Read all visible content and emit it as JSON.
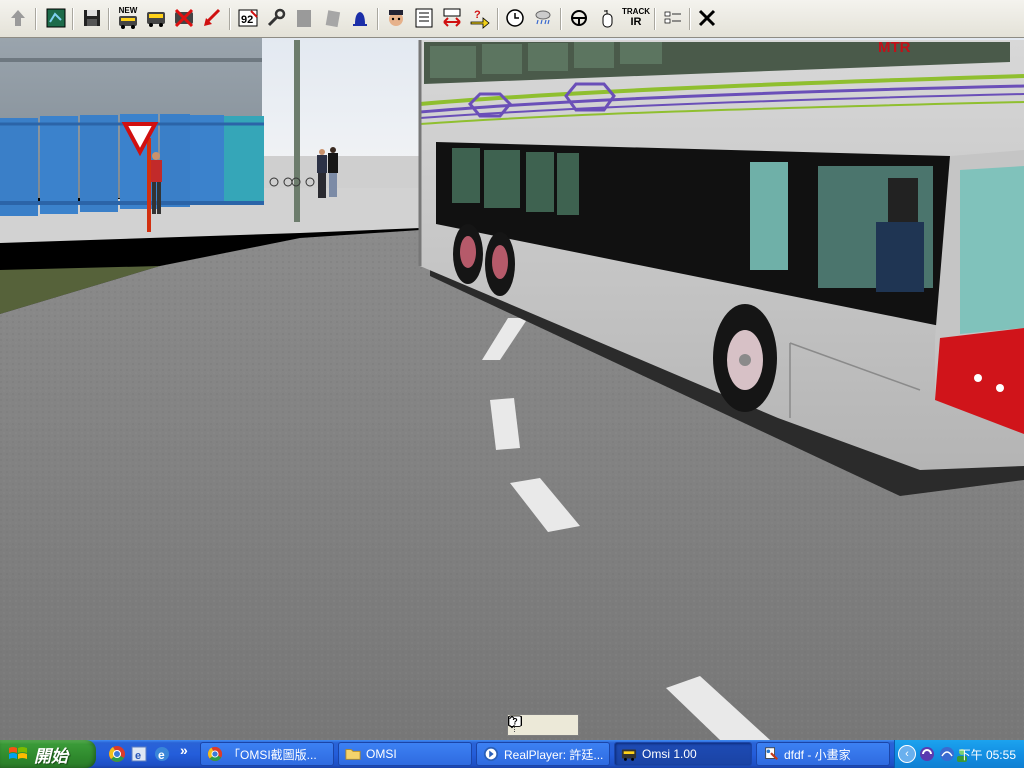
{
  "toolbar": {
    "icons": [
      "arrow-up-icon",
      "map-icon",
      "save-icon",
      "new-bus-icon",
      "bus-icon",
      "delete-bus-icon",
      "pointer-icon",
      "timetable-icon",
      "wrench-icon",
      "door-icon",
      "ticket-icon",
      "bell-icon",
      "driver-icon",
      "schedule-icon",
      "swap-icon",
      "help-arrow-icon",
      "clock-icon",
      "weather-icon",
      "steering-icon",
      "mouse-icon",
      "track-ir-icon",
      "options-icon",
      "close-icon"
    ],
    "new_label": "NEW",
    "track_label": "TRACK",
    "ir_label": "IR",
    "ninety_two_label": "92"
  },
  "scene": {
    "bus_brand": "MTR",
    "colors": {
      "sky": "#e8ecf2",
      "road": "#7d7d7d",
      "bus_body": "#c9c9c9",
      "bus_red": "#d0141a",
      "toilets": "#3a7fc8",
      "stripe_purple": "#6a4fb8",
      "stripe_green": "#8fbf2f"
    }
  },
  "taskbar": {
    "start_label": "開始",
    "more_label": "»",
    "tasks": [
      {
        "label": "「OMSI截圖版...",
        "icon": "chrome-icon"
      },
      {
        "label": "OMSI",
        "icon": "folder-icon"
      },
      {
        "label": "RealPlayer: 許廷...",
        "icon": "realplayer-icon"
      },
      {
        "label": "Omsi 1.00",
        "icon": "omsi-icon",
        "active": true
      },
      {
        "label": "dfdf - 小畫家",
        "icon": "paint-icon"
      }
    ],
    "clock": "下午 05:55"
  }
}
